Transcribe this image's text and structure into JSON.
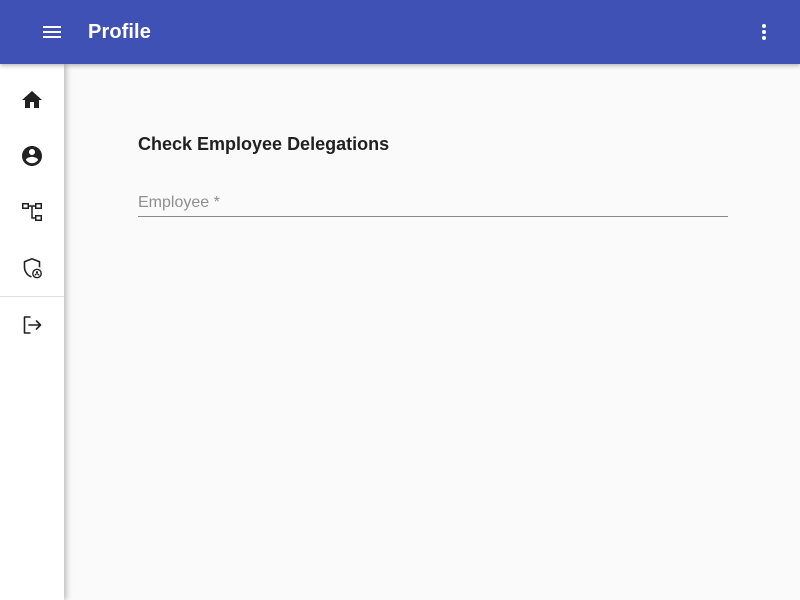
{
  "appbar": {
    "title": "Profile",
    "menu_icon": "menu-icon",
    "more_icon": "more-vert-icon",
    "color": "#3f51b5"
  },
  "sidebar": {
    "items": [
      {
        "icon": "home-icon"
      },
      {
        "icon": "account-circle-icon"
      },
      {
        "icon": "org-tree-icon"
      },
      {
        "icon": "admin-shield-icon"
      },
      {
        "icon": "logout-icon"
      }
    ]
  },
  "main": {
    "section_title": "Check Employee Delegations",
    "employee_field": {
      "placeholder": "Employee *",
      "value": ""
    }
  }
}
